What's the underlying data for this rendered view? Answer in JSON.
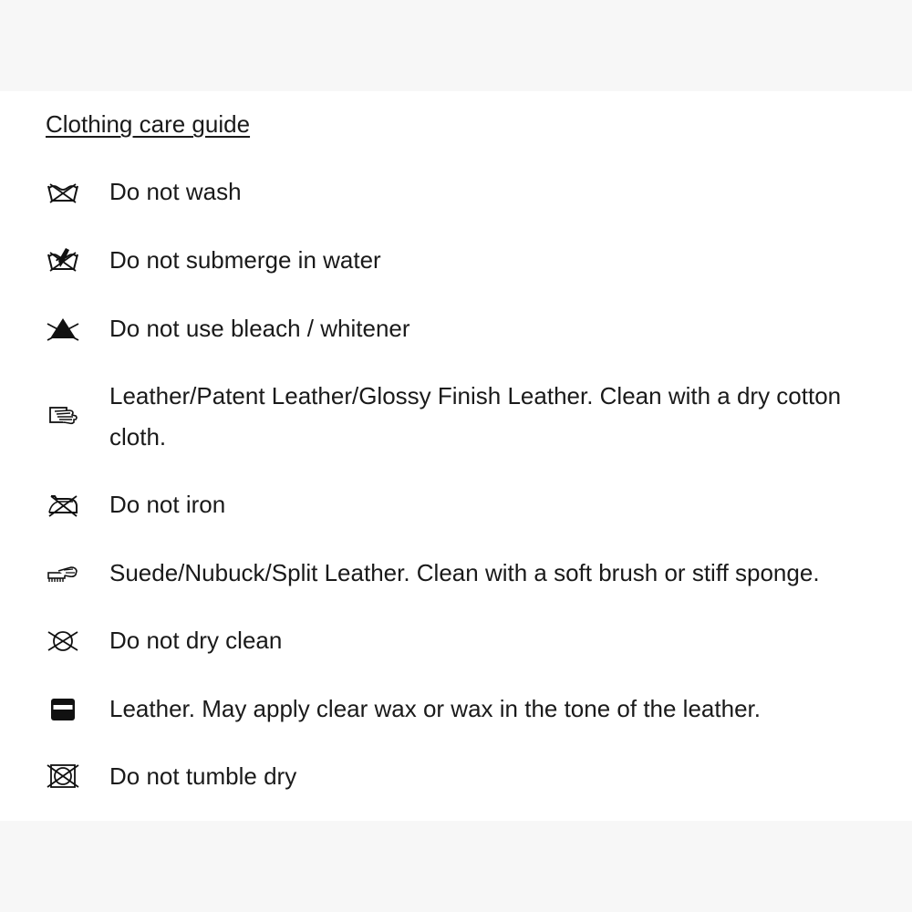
{
  "guide": {
    "title": "Clothing care guide",
    "items": [
      {
        "icon": "do-not-wash-icon",
        "text": "Do not wash"
      },
      {
        "icon": "do-not-submerge-icon",
        "text": "Do not submerge in water"
      },
      {
        "icon": "do-not-bleach-icon",
        "text": "Do not use bleach / whitener"
      },
      {
        "icon": "wipe-with-cloth-icon",
        "text_line1": "Leather/Patent Leather/Glossy Finish Leather. Clean with a dry cotton",
        "text_line2": "cloth."
      },
      {
        "icon": "do-not-iron-icon",
        "text": "Do not iron"
      },
      {
        "icon": "brush-icon",
        "text": "Suede/Nubuck/Split Leather. Clean with a soft brush or stiff sponge."
      },
      {
        "icon": "do-not-dry-clean-icon",
        "text": "Do not dry clean"
      },
      {
        "icon": "wax-tin-icon",
        "text": "Leather. May apply clear wax or wax in the tone of the leather."
      },
      {
        "icon": "do-not-tumble-dry-icon",
        "text": "Do not tumble dry"
      }
    ]
  }
}
